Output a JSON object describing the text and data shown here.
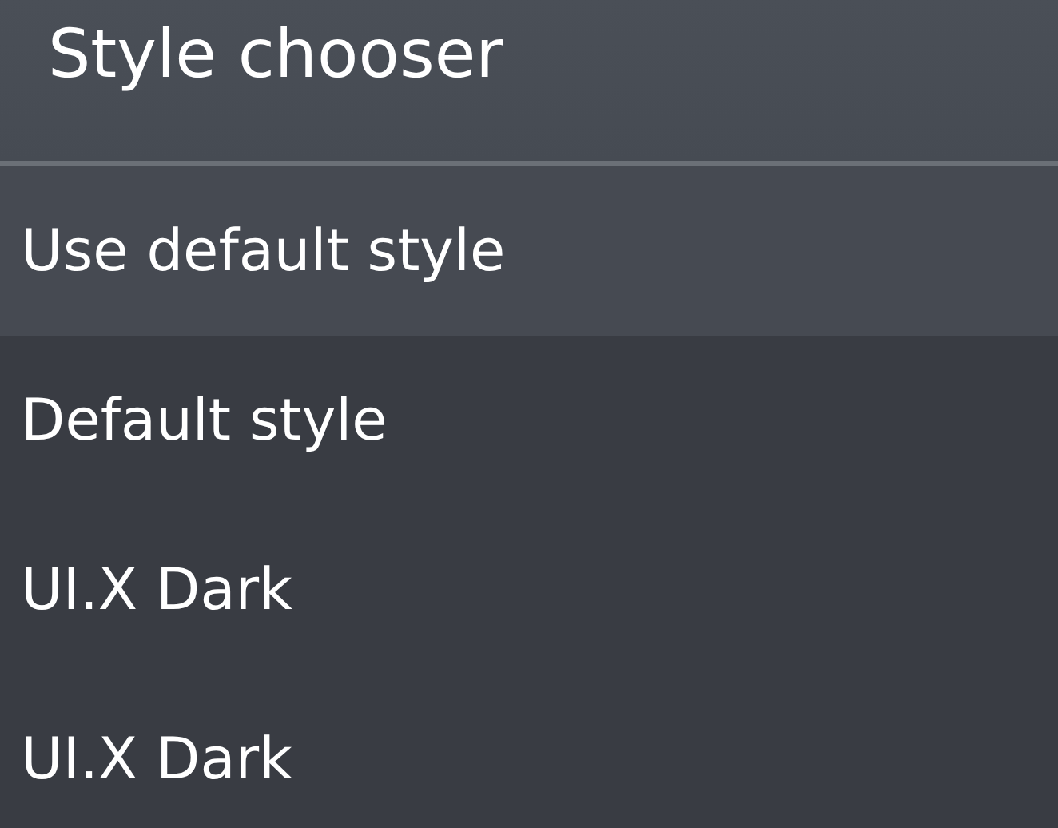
{
  "dialog": {
    "title": "Style chooser"
  },
  "items": [
    {
      "label": "Use default style",
      "selected": true
    },
    {
      "label": "Default style",
      "selected": false
    },
    {
      "label": "UI.X Dark",
      "selected": false
    },
    {
      "label": "UI.X Dark",
      "selected": false
    }
  ]
}
